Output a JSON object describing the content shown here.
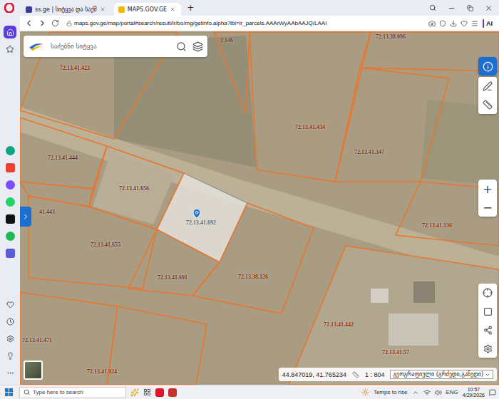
{
  "browser": {
    "tabs": [
      {
        "label": "ss.ge | სიტყვა და საქმ",
        "selected": false
      },
      {
        "label": "MAPS.GOV.GE",
        "selected": true
      }
    ],
    "new_tab": "+",
    "url": "maps.gov.ge/map/portal#search/result/lr/bo/mg/getinfo.alpha?lbl=lr_parcels.AAArWyAAbAAJQ/LAAI",
    "ai_button": "AI"
  },
  "sidebar": {
    "items": [
      {
        "kind": "home",
        "selected": true
      },
      {
        "kind": "bookmarks",
        "selected": false
      },
      {
        "kind": "chatgpt",
        "selected": false
      },
      {
        "kind": "gmail",
        "selected": false
      },
      {
        "kind": "messenger",
        "selected": false
      },
      {
        "kind": "whatsapp",
        "selected": false
      },
      {
        "kind": "tiktok",
        "selected": false
      },
      {
        "kind": "spotify",
        "selected": false
      },
      {
        "kind": "player",
        "selected": false
      }
    ]
  },
  "map": {
    "search": {
      "placeholder": "საძებნი სიტყვა"
    },
    "tools": [
      {
        "kind": "info",
        "selected": true
      },
      {
        "kind": "draw",
        "selected": false
      },
      {
        "kind": "measure",
        "selected": false
      }
    ],
    "zoom": {
      "in": "+",
      "out": "−"
    },
    "parcels": [
      {
        "label": "1.146",
        "selected": false
      },
      {
        "label": "72.13.41.423",
        "selected": false
      },
      {
        "label": "72.13.38.096",
        "selected": false
      },
      {
        "label": "72.13.41.434",
        "selected": false
      },
      {
        "label": "72.13.41.444",
        "selected": false
      },
      {
        "label": "72.13.41.347",
        "selected": false
      },
      {
        "label": "72.13.41.656",
        "selected": false
      },
      {
        "label": "41.443",
        "selected": false
      },
      {
        "label": "72.13.41.692",
        "selected": true
      },
      {
        "label": "72.13.41.136",
        "selected": false
      },
      {
        "label": "72.13.41.655",
        "selected": false
      },
      {
        "label": "72.13.41.691",
        "selected": false
      },
      {
        "label": "72.13.38.126",
        "selected": false
      },
      {
        "label": "72.13.41.442",
        "selected": false
      },
      {
        "label": "72.13.41.57",
        "selected": false
      },
      {
        "label": "72.13.41.471",
        "selected": false
      },
      {
        "label": "72.13.41.924",
        "selected": false
      }
    ],
    "coordinates": "44.847019, 41.765234",
    "scale": "1 : 804",
    "projection": "გეოგრაფიული (გრძედი,განედი)"
  },
  "taskbar": {
    "search_placeholder": "Type here to search",
    "weather": "Temps to rise",
    "language": "ENG",
    "time": "10:57",
    "date": "4/29/2026"
  }
}
